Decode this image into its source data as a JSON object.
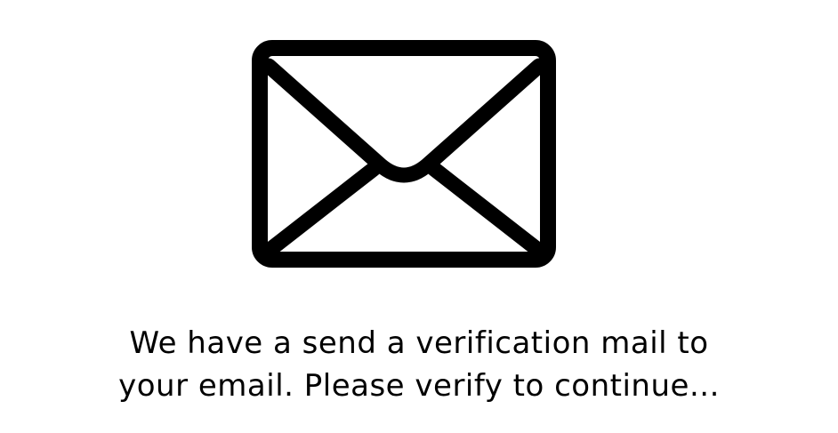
{
  "icon": {
    "name": "mail-envelope-icon",
    "stroke_color": "#000000",
    "background_color": "#ffffff"
  },
  "message": {
    "line1": "We have a send a verification mail to",
    "line2": "your email. Please verify to continue..."
  },
  "colors": {
    "page_background": "#ffffff",
    "text": "#000000"
  }
}
